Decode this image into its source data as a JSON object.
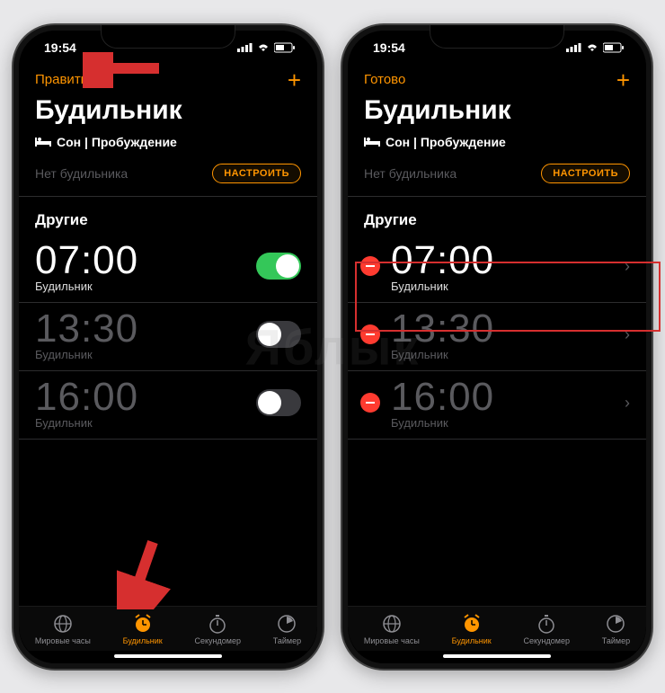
{
  "watermark": "Яблык",
  "left": {
    "status": {
      "time": "19:54"
    },
    "nav": {
      "left_button": "Править",
      "plus": "+"
    },
    "title": "Будильник",
    "sleep_section": {
      "icon": "bed-icon",
      "label": "Сон | Пробуждение"
    },
    "sleep_sub": {
      "empty_text": "Нет будильника",
      "setup_button": "НАСТРОИТЬ"
    },
    "others_header": "Другие",
    "alarms": [
      {
        "time": "07:00",
        "label": "Будильник",
        "enabled": true
      },
      {
        "time": "13:30",
        "label": "Будильник",
        "enabled": false
      },
      {
        "time": "16:00",
        "label": "Будильник",
        "enabled": false
      }
    ],
    "tabs": [
      {
        "icon": "globe-icon",
        "label": "Мировые часы",
        "active": false
      },
      {
        "icon": "alarm-icon",
        "label": "Будильник",
        "active": true
      },
      {
        "icon": "stopwatch-icon",
        "label": "Секундомер",
        "active": false
      },
      {
        "icon": "timer-icon",
        "label": "Таймер",
        "active": false
      }
    ]
  },
  "right": {
    "status": {
      "time": "19:54"
    },
    "nav": {
      "left_button": "Готово",
      "plus": "+"
    },
    "title": "Будильник",
    "sleep_section": {
      "icon": "bed-icon",
      "label": "Сон | Пробуждение"
    },
    "sleep_sub": {
      "empty_text": "Нет будильника",
      "setup_button": "НАСТРОИТЬ"
    },
    "others_header": "Другие",
    "alarms": [
      {
        "time": "07:00",
        "label": "Будильник",
        "highlighted": true
      },
      {
        "time": "13:30",
        "label": "Будильник",
        "highlighted": false
      },
      {
        "time": "16:00",
        "label": "Будильник",
        "highlighted": false
      }
    ],
    "tabs": [
      {
        "icon": "globe-icon",
        "label": "Мировые часы",
        "active": false
      },
      {
        "icon": "alarm-icon",
        "label": "Будильник",
        "active": true
      },
      {
        "icon": "stopwatch-icon",
        "label": "Секундомер",
        "active": false
      },
      {
        "icon": "timer-icon",
        "label": "Таймер",
        "active": false
      }
    ]
  }
}
